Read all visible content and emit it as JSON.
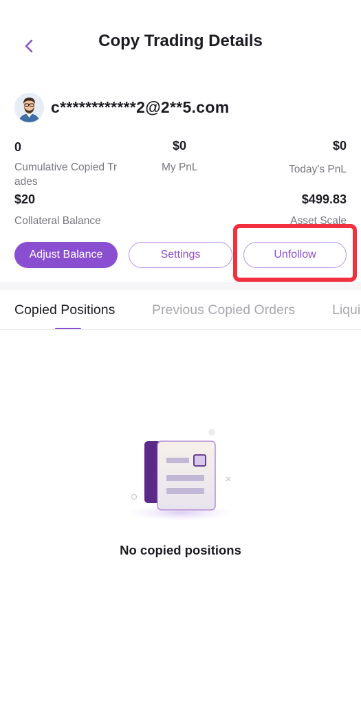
{
  "header": {
    "title": "Copy Trading Details",
    "back_icon": "chevron-left-icon"
  },
  "trader": {
    "email": "c************2@2**5.com",
    "avatar_icon": "user-avatar"
  },
  "stats": {
    "cumulative_copied_trades": {
      "value": "0",
      "label": "Cumulative Copied Tr ades"
    },
    "my_pnl": {
      "value": "$0",
      "label": "My PnL"
    },
    "todays_pnl": {
      "value": "$0",
      "label": "Today's PnL"
    },
    "collateral_balance": {
      "value": "$20",
      "label": "Collateral Balance"
    },
    "asset_scale": {
      "value": "$499.83",
      "label": "Asset Scale"
    }
  },
  "actions": {
    "adjust_balance": "Adjust Balance",
    "settings": "Settings",
    "unfollow": "Unfollow"
  },
  "tabs": [
    {
      "label": "Copied Positions",
      "active": true
    },
    {
      "label": "Previous Copied Orders",
      "active": false
    },
    {
      "label": "Liqui",
      "active": false
    }
  ],
  "empty_state": {
    "message": "No copied positions",
    "icon": "empty-document-icon"
  },
  "colors": {
    "accent": "#8a4fd1",
    "accent_border": "#b98fe6",
    "highlight": "#f2303f",
    "text_primary": "#1b1b22",
    "text_secondary": "#77767f"
  }
}
